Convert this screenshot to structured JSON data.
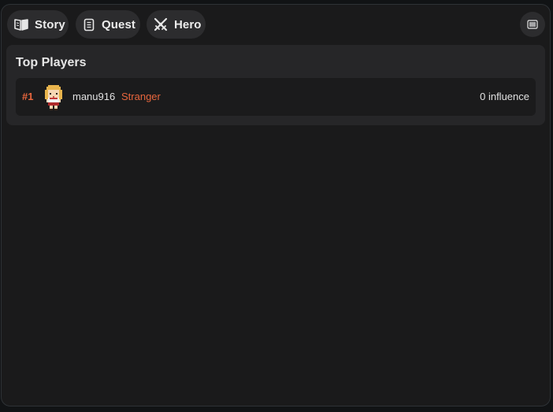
{
  "nav": {
    "tabs": [
      {
        "label": "Story",
        "icon": "book-icon"
      },
      {
        "label": "Quest",
        "icon": "scroll-icon"
      },
      {
        "label": "Hero",
        "icon": "crossed-swords-icon"
      }
    ],
    "menu_icon": "hamburger-menu-icon"
  },
  "leaderboard": {
    "title": "Top Players",
    "players": [
      {
        "rank": "#1",
        "avatar": "pixel-hero-avatar",
        "name": "manu916",
        "title": "Stranger",
        "influence": "0 influence"
      }
    ]
  },
  "colors": {
    "accent": "#e8663d",
    "background": "#1a1a1b",
    "panel": "#262628",
    "row": "#1b1b1c",
    "pill": "#2c2c2e"
  }
}
